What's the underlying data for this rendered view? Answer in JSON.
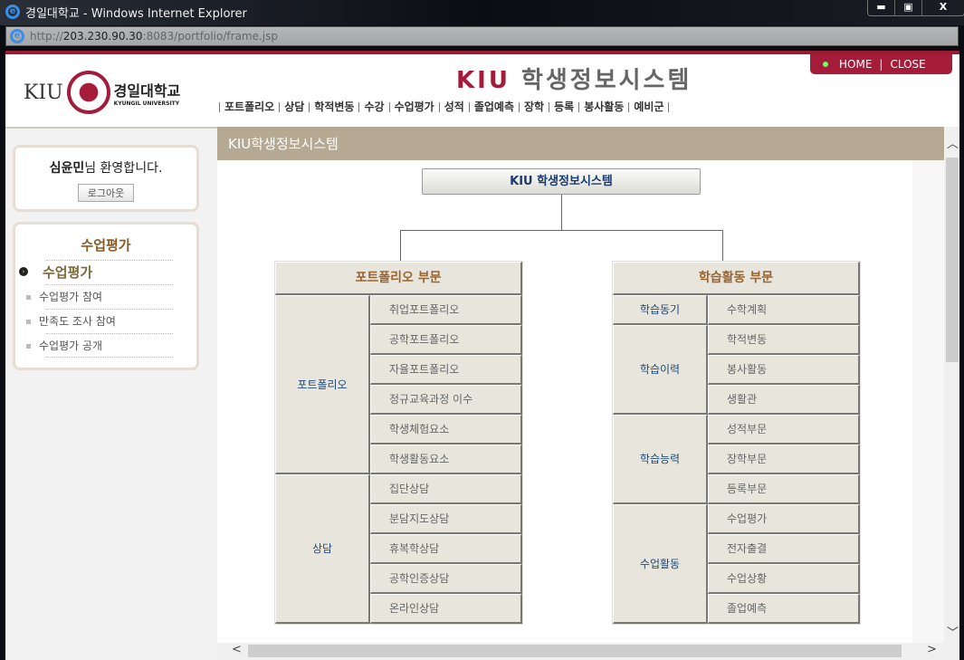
{
  "window": {
    "title": "경일대학교 - Windows Internet Explorer",
    "url_prefix": "http://",
    "url_host": "203.230.90.30",
    "url_rest": ":8083/portfolio/frame.jsp",
    "min": "▬",
    "max": "▣",
    "close": "X"
  },
  "header": {
    "logo_kiu": "KIU",
    "logo_ko": "경일대학교",
    "logo_en": "KYUNGIL UNIVERSITY",
    "sys_brand": "KIU",
    "sys_title": "학생정보시스템",
    "home": "HOME",
    "sep": "|",
    "close": "CLOSE",
    "nav": [
      "포트폴리오",
      "상담",
      "학적변동",
      "수강",
      "수업평가",
      "성적",
      "졸업예측",
      "장학",
      "등록",
      "봉사활동",
      "예비군"
    ]
  },
  "sidebar": {
    "user_name": "심윤민",
    "welcome_suffix": "님 환영합니다.",
    "logout": "로그아웃",
    "menu_title": "수업평가",
    "items": [
      {
        "label": "수업평가",
        "active": true
      },
      {
        "label": "수업평가 참여"
      },
      {
        "label": "만족도 조사 참여"
      },
      {
        "label": "수업평가 공개"
      }
    ]
  },
  "content": {
    "title": "KIU학생정보시스템",
    "root": "KIU 학생정보시스템",
    "left": {
      "header": "포트폴리오 부문",
      "groups": [
        {
          "name": "포트폴리오",
          "items": [
            "취업포트폴리오",
            "공학포트폴리오",
            "자율포트폴리오",
            "정규교육과정 이수",
            "학생체험요소",
            "학생활동요소"
          ]
        },
        {
          "name": "상담",
          "items": [
            "집단상담",
            "분담지도상담",
            "휴복학상담",
            "공학인증상담",
            "온라인상담"
          ]
        }
      ]
    },
    "right": {
      "header": "학습활동 부문",
      "groups": [
        {
          "name": "학습동기",
          "items": [
            "수학계획"
          ]
        },
        {
          "name": "학습이력",
          "items": [
            "학적변동",
            "봉사활동",
            "생활관"
          ]
        },
        {
          "name": "학습능력",
          "items": [
            "성적부문",
            "장학부문",
            "등록부문"
          ]
        },
        {
          "name": "수업활동",
          "items": [
            "수업평가",
            "전자출결",
            "수업상황",
            "졸업예측"
          ]
        }
      ]
    }
  },
  "colors": {
    "brand": "#a51c3a",
    "title_band": "#b5a994",
    "cell": "#e8e5dc",
    "section_header": "#9a6430",
    "group": "#1f4a7a"
  }
}
